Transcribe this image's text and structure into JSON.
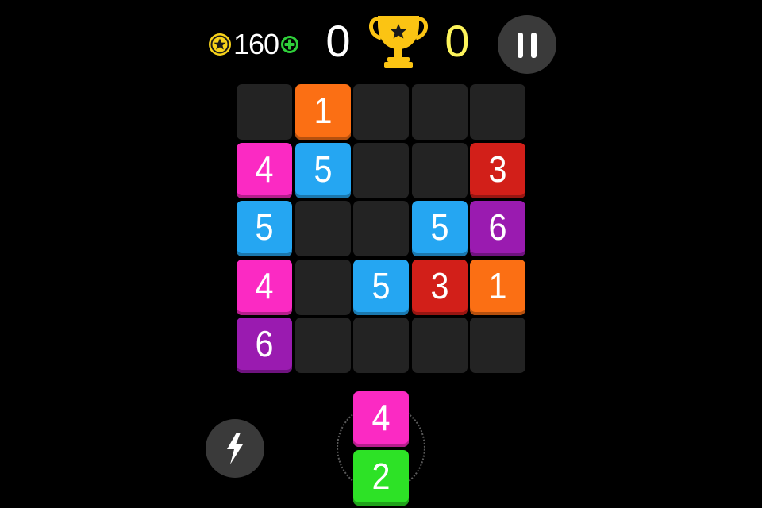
{
  "hud": {
    "coins": "160",
    "score": "0",
    "best": "0"
  },
  "icons": {
    "coin": "coin-icon",
    "add_coins": "plus-icon",
    "trophy": "trophy-icon",
    "pause": "pause-icon",
    "power": "lightning-icon"
  },
  "colors": {
    "background": "#000000",
    "empty_cell": "#232323",
    "button": "#3a3a3a",
    "coin": "#f7d21a",
    "plus": "#2fcf3a",
    "trophy": "#fbc413",
    "best_score": "#fdf45b",
    "tile_1": "#fb6f14",
    "tile_2": "#2de226",
    "tile_3": "#d21f19",
    "tile_4": "#fb2ac3",
    "tile_5": "#25a6f2",
    "tile_6": "#9a1bb0"
  },
  "board": {
    "rows": [
      [
        null,
        "1",
        null,
        null,
        null
      ],
      [
        "4",
        "5",
        null,
        null,
        "3"
      ],
      [
        "5",
        null,
        null,
        "5",
        "6"
      ],
      [
        "4",
        null,
        "5",
        "3",
        "1"
      ],
      [
        "6",
        null,
        null,
        null,
        null
      ]
    ]
  },
  "next_piece": [
    "4",
    "2"
  ]
}
